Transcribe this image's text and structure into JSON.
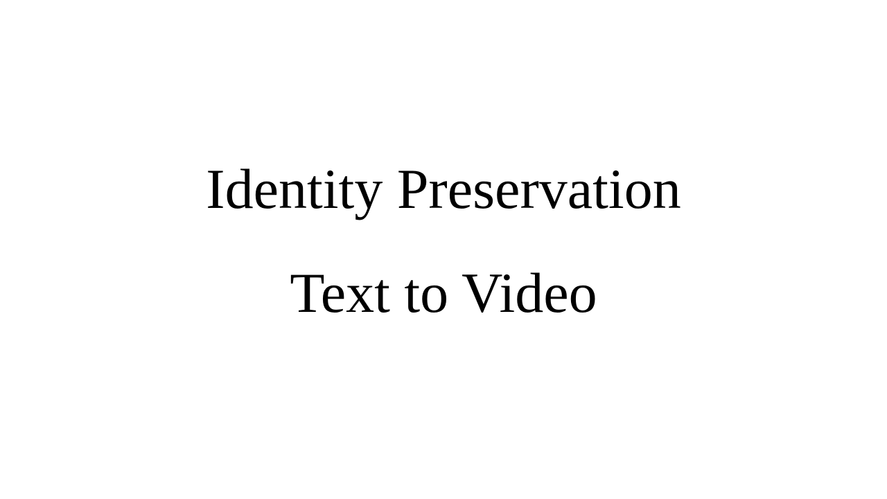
{
  "slide": {
    "title": "Identity Preservation",
    "subtitle": "Text to Video",
    "background_color": "#ffffff",
    "text_color": "#000000"
  }
}
